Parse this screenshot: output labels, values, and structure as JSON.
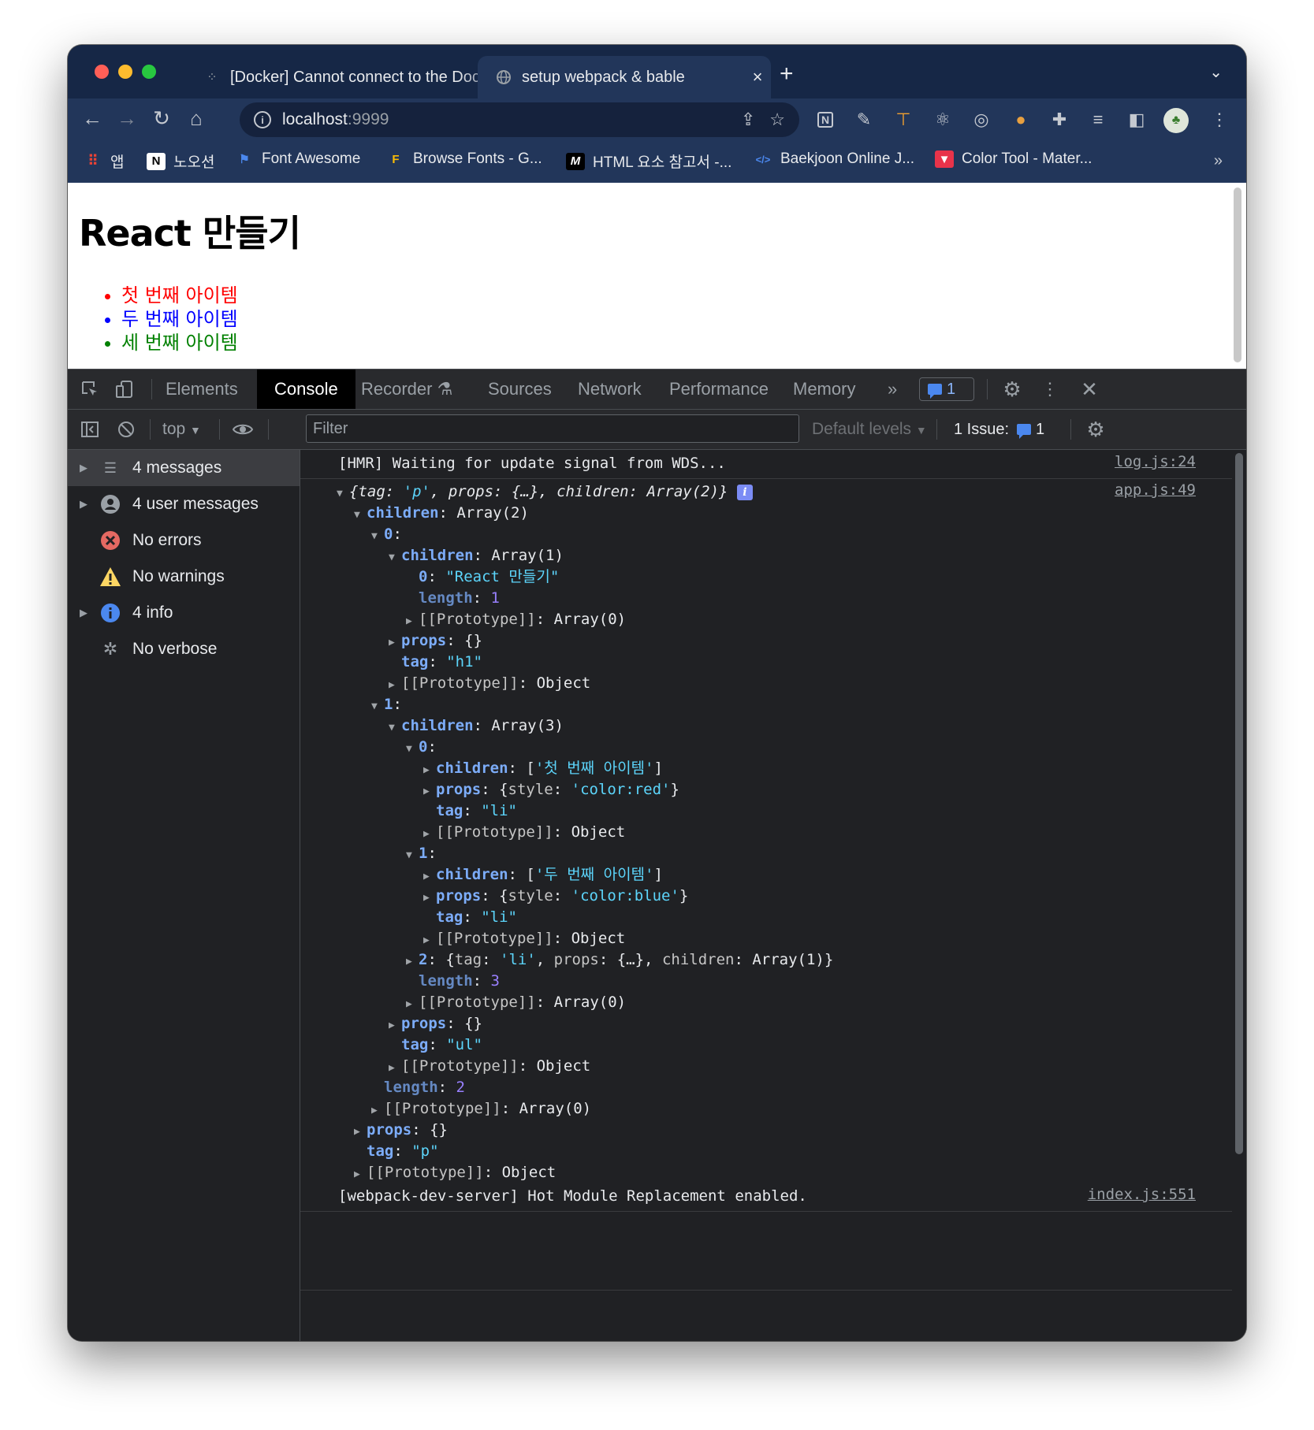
{
  "browser": {
    "tabs": [
      {
        "title": "[Docker] Cannot connect to the Docker daemon",
        "close": "×",
        "active": false
      },
      {
        "title": "setup webpack & bable",
        "close": "×",
        "active": true
      }
    ],
    "new_tab": "+",
    "tab_menu": "⌄",
    "nav": {
      "back": "←",
      "forward": "→",
      "reload": "↻",
      "home": "⌂"
    },
    "url_host": "localhost",
    "url_port": ":9999",
    "bookmarks": [
      {
        "label": "앱",
        "icon": "apps-grid-icon"
      },
      {
        "label": "노오션",
        "icon": "notion-icon"
      },
      {
        "label": "Font Awesome",
        "icon": "flag-icon"
      },
      {
        "label": "Browse Fonts - G...",
        "icon": "google-fonts-icon"
      },
      {
        "label": "HTML 요소 참고서 -...",
        "icon": "mdn-icon"
      },
      {
        "label": "Baekjoon Online J...",
        "icon": "code-icon"
      },
      {
        "label": "Color Tool - Mater...",
        "icon": "material-icon"
      }
    ],
    "bookmarks_more": "»"
  },
  "page": {
    "heading": "React 만들기",
    "items": [
      {
        "text": "첫 번째 아이템",
        "color": "#ff0000"
      },
      {
        "text": "두 번째 아이템",
        "color": "#0000ff"
      },
      {
        "text": "세 번째 아이템",
        "color": "#008000"
      }
    ]
  },
  "devtools": {
    "tabs": [
      "Elements",
      "Console",
      "Recorder",
      "Sources",
      "Network",
      "Performance",
      "Memory"
    ],
    "active_tab": "Console",
    "more_tabs": "»",
    "issues_badge_count": "1",
    "context": "top",
    "filter_placeholder": "Filter",
    "levels": "Default levels",
    "issues_label": "1 Issue:",
    "issues_count": "1",
    "sidebar": [
      {
        "label": "4 messages",
        "icon": "list-icon",
        "expandable": true,
        "selected": true
      },
      {
        "label": "4 user messages",
        "icon": "user-icon",
        "expandable": true,
        "selected": false
      },
      {
        "label": "No errors",
        "icon": "error-icon",
        "expandable": false,
        "selected": false
      },
      {
        "label": "No warnings",
        "icon": "warning-icon",
        "expandable": false,
        "selected": false
      },
      {
        "label": "4 info",
        "icon": "info-icon",
        "expandable": true,
        "selected": false
      },
      {
        "label": "No verbose",
        "icon": "bug-icon",
        "expandable": false,
        "selected": false
      }
    ],
    "console": {
      "msg1": {
        "text": "[HMR] Waiting for update signal from WDS...",
        "source": "log.js:24"
      },
      "msg2_source": "app.js:49",
      "msg3": {
        "text": "[webpack-dev-server] Hot Module Replacement enabled.",
        "source": "index.js:551"
      }
    }
  }
}
